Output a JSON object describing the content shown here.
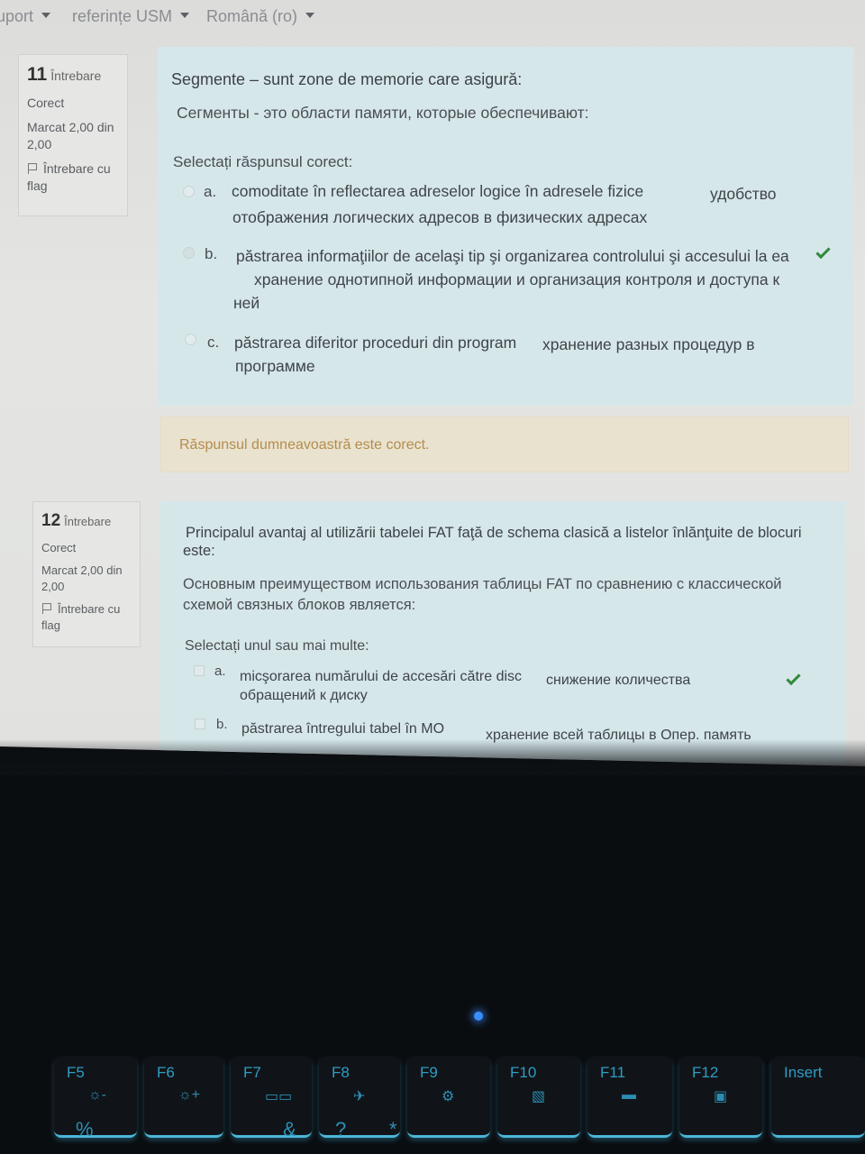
{
  "topbar": {
    "items": [
      "uport",
      "referințe USM",
      "Română (ro)"
    ]
  },
  "q11": {
    "number": "11",
    "word": "Întrebare",
    "state": "Corect",
    "mark_line1": "Marcat 2,00 din",
    "mark_line2": "2,00",
    "flag_line1": "Întrebare cu",
    "flag_line2": "flag",
    "text_ro": "Segmente – sunt zone de memorie care asigură:",
    "text_ru": "Сегменты - это области памяти, которые обеспечивают:",
    "prompt": "Selectați răspunsul corect:",
    "options": [
      {
        "letter": "a.",
        "line1": "comoditate în reflectarea adreselor logice în adresele fizice",
        "line1_ru": "удобство",
        "line2": "отображения логических адресов в физических адресах",
        "line3": "",
        "selected": false,
        "correct": false
      },
      {
        "letter": "b.",
        "line1": "păstrarea informaţiilor de acelaşi tip şi organizarea controlului şi accesului la ea",
        "line1_ru": "",
        "line2": "хранение однотипной информации и организация контроля и доступа к",
        "line3": "ней",
        "selected": true,
        "correct": true
      },
      {
        "letter": "c.",
        "line1": "păstrarea diferitor proceduri din program",
        "line1_ru": "хранение разных процедур в",
        "line2": "программе",
        "line3": "",
        "selected": false,
        "correct": false
      }
    ],
    "feedback": "Răspunsul dumneavoastră este corect."
  },
  "q12": {
    "number": "12",
    "word": "Întrebare",
    "state": "Corect",
    "mark_line1": "Marcat 2,00 din",
    "mark_line2": "2,00",
    "flag_line1": "Întrebare cu",
    "flag_line2": "flag",
    "text_ro_line1": "Principalul avantaj al utilizării tabelei FAT faţă de schema clasică a listelor înlănţuite de blocuri",
    "text_ro_line2": "este:",
    "text_ru_line1": "Основным преимуществом использования таблицы FAT по сравнению с классической",
    "text_ru_line2": "схемой связных блоков является:",
    "prompt": "Selectați unul sau mai multe:",
    "options": [
      {
        "letter": "a.",
        "line1": "micşorarea numărului de accesări către disc",
        "line1_ru": "снижение количества",
        "line2": "обращений к диску",
        "selected": true,
        "correct": true
      },
      {
        "letter": "b.",
        "line1": "păstrarea întregului tabel în MO",
        "line1_ru": "хранение всей таблицы в Опер. память",
        "line2": "",
        "selected": false,
        "correct": false
      }
    ]
  },
  "keyboard": {
    "fkeys": [
      {
        "label": "F5",
        "icon": "☼-"
      },
      {
        "label": "F6",
        "icon": "☼+"
      },
      {
        "label": "F7",
        "icon": "▭▭"
      },
      {
        "label": "F8",
        "icon": "✈"
      },
      {
        "label": "F9",
        "icon": "⚙"
      },
      {
        "label": "F10",
        "icon": "▧"
      },
      {
        "label": "F11",
        "icon": "▬"
      },
      {
        "label": "F12",
        "icon": "▣"
      },
      {
        "label": "Insert",
        "icon": ""
      }
    ],
    "number_row": [
      "%",
      "&",
      "?",
      "*"
    ]
  },
  "colors": {
    "panel_bg": "#d6e7ea",
    "feedback_bg": "#e9e2cf",
    "feedback_text": "#b48d4e",
    "check": "#2f8a3c",
    "key_glow": "#4bb6d8",
    "led": "#3a8dff"
  }
}
